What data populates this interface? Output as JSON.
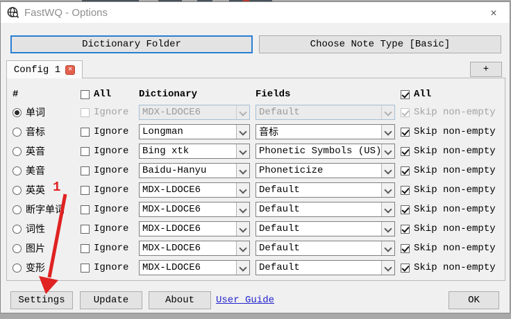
{
  "window": {
    "title": "FastWQ - Options",
    "close_glyph": "✕"
  },
  "toolbar": {
    "dictionary_folder": "Dictionary Folder",
    "choose_note_type": "Choose Note Type [Basic]"
  },
  "tabs": {
    "active_tab": "Config 1",
    "tab_close_glyph": "✕",
    "add_button": "+"
  },
  "table": {
    "headers": {
      "number": "#",
      "all_ignore": "All",
      "dictionary": "Dictionary",
      "fields": "Fields",
      "all_skip": "All"
    },
    "ignore_label": "Ignore",
    "skip_label": "Skip non-empty",
    "rows": [
      {
        "name": "单词",
        "dict": "MDX-LDOCE6",
        "field": "Default",
        "selected": true,
        "disabled": true
      },
      {
        "name": "音标",
        "dict": "Longman",
        "field": "音标"
      },
      {
        "name": "英音",
        "dict": "Bing xtk",
        "field": "Phonetic Symbols (US)"
      },
      {
        "name": "美音",
        "dict": "Baidu-Hanyu",
        "field": "Phoneticize"
      },
      {
        "name": "英英",
        "dict": "MDX-LDOCE6",
        "field": "Default"
      },
      {
        "name": "断字单词",
        "dict": "MDX-LDOCE6",
        "field": "Default"
      },
      {
        "name": "词性",
        "dict": "MDX-LDOCE6",
        "field": "Default"
      },
      {
        "name": "图片",
        "dict": "MDX-LDOCE6",
        "field": "Default"
      },
      {
        "name": "变形",
        "dict": "MDX-LDOCE6",
        "field": "Default"
      }
    ]
  },
  "footer": {
    "settings": "Settings",
    "update": "Update",
    "about": "About",
    "user_guide": "User Guide",
    "ok": "OK"
  },
  "annotation": {
    "step_label": "1",
    "color": "#e02222"
  }
}
